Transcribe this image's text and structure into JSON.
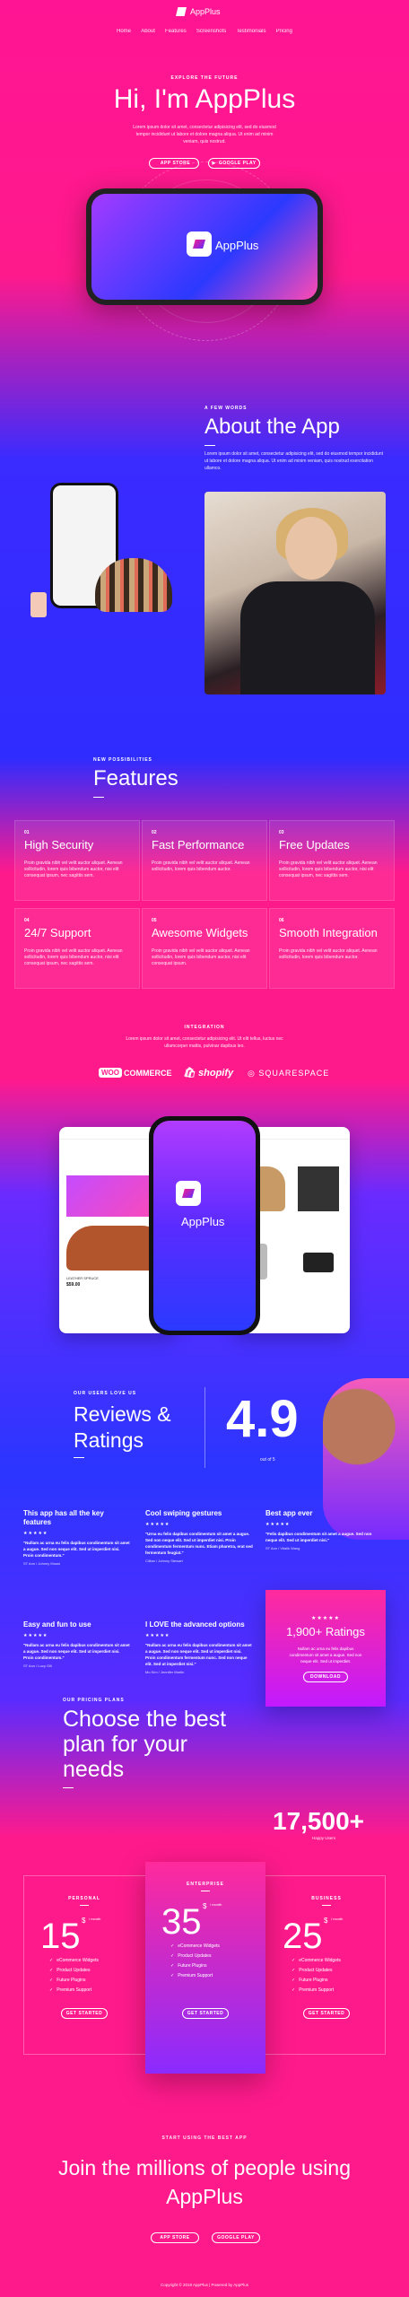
{
  "nav": {
    "brand": "AppPlus",
    "links": [
      "Home",
      "About",
      "Features",
      "Screenshots",
      "Testimonials",
      "Pricing"
    ]
  },
  "hero": {
    "eyebrow": "EXPLORE THE FUTURE",
    "title": "Hi, I'm AppPlus",
    "text": "Lorem ipsum dolor sit amet, consectetur adipisicing elit, sed do eiusmod tempor incididunt ut labore et dolore magna aliqua. Ut enim ad minim veniam, quis nostrud.",
    "btn_app_store": "APP STORE",
    "btn_google_play": "GOOGLE PLAY",
    "phone_app_name": "AppPlus"
  },
  "about": {
    "eyebrow": "A FEW WORDS",
    "title": "About the App",
    "text": "Lorem ipsum dolor sit amet, consectetur adipisicing elit, sed do eiusmod tempor incididunt ut labore et dolore magna aliqua. Ut enim ad minim veniam, quis nostrud exercitation ullamco."
  },
  "features": {
    "eyebrow": "NEW POSSIBILITIES",
    "title": "Features",
    "items": [
      {
        "num": "01",
        "title": "High Security",
        "text": "Proin gravida nibh vel velit auctor aliquet. Aenean sollicitudin, lorem quis bibendum auctor, nisi elit consequat ipsum, nec sagittis sem."
      },
      {
        "num": "02",
        "title": "Fast Performance",
        "text": "Proin gravida nibh vel velit auctor aliquet. Aenean sollicitudin, lorem quis bibendum auctor."
      },
      {
        "num": "03",
        "title": "Free Updates",
        "text": "Proin gravida nibh vel velit auctor aliquet. Aenean sollicitudin, lorem quis bibendum auctor, nisi elit consequat ipsum, nec sagittis sem."
      },
      {
        "num": "04",
        "title": "24/7 Support",
        "text": "Proin gravida nibh vel velit auctor aliquet. Aenean sollicitudin, lorem quis bibendum auctor, nisi elit consequat ipsum, nec sagittis sem."
      },
      {
        "num": "05",
        "title": "Awesome Widgets",
        "text": "Proin gravida nibh vel velit auctor aliquet. Aenean sollicitudin, lorem quis bibendum auctor, nisi elit consequat ipsum."
      },
      {
        "num": "06",
        "title": "Smooth Integration",
        "text": "Proin gravida nibh vel velit auctor aliquet. Aenean sollicitudin, lorem quis bibendum auctor."
      }
    ]
  },
  "integration": {
    "eyebrow": "INTEGRATION",
    "text": "Lorem ipsum dolor sit amet, consectetur adipisicing elit. Ut elit tellus, luctus nec ullamcorper mattis, pulvinar dapibus leo.",
    "woo_badge": "WOO",
    "woo_text": "COMMERCE",
    "shopify": "shopify",
    "squarespace": "SQUARESPACE",
    "panel_left_caption": "LEATHER SPRUCE",
    "panel_left_price": "$59.00",
    "phone_app_name": "AppPlus"
  },
  "reviews": {
    "eyebrow": "OUR USERS LOVE US",
    "title": "Reviews & Ratings",
    "score": "4.9",
    "out_of": "out of 5",
    "items": [
      {
        "title": "This app has all the key features",
        "stars": "★★★★★",
        "text": "\"Nullam ac urna eu felis dapibus condimentum sit amet a augue. Sed non neque elit. Sed ut imperdiet nisi. Proin condimentum.\"",
        "by": "ST Ann / Johnny Mussi"
      },
      {
        "title": "Cool swiping gestures",
        "stars": "★★★★★",
        "text": "\"Urna eu felis dapibus condimentum sit amet a augue. Sed non neque elit. Sed ut imperdiet nisi. Proin condimentum fermentum nunc. Etiam pharetra, erat sed fermentum feugiat.\"",
        "by": "Cillian / Johnny Stewart"
      },
      {
        "title": "Best app ever",
        "stars": "★★★★★",
        "text": "\"Felis dapibus condimentum sit amet a augue. Sed non neque elit. Sed ut imperdiet nisi.\"",
        "by": "ST Ann / Vitalik Wang"
      },
      {
        "title": "Easy and fun to use",
        "stars": "★★★★★",
        "text": "\"Nullam ac urna eu felis dapibus condimentum sit amet a augue. Sed non neque elit. Sed ut imperdiet nisi. Proin condimentum.\"",
        "by": "ST Ann / Lucy Gill"
      },
      {
        "title": "I LOVE the advanced options",
        "stars": "★★★★★",
        "text": "\"Nullam ac urna eu felis dapibus condimentum sit amet a augue. Sed non neque elit. Sed ut imperdiet nisi. Proin condimentum fermentum nunc. Sed non neque elit. Sed ut imperdiet nisi.\"",
        "by": "Mo Kim / Jennifer Martin"
      }
    ],
    "card_stars": "★★★★★",
    "card_big": "1,900+ Ratings",
    "card_text": "Nullam ac urna eu felis dapibus condimentum sit amet a augue. Sed non neque elit. Sed ut imperdiet.",
    "card_btn": "DOWNLOAD"
  },
  "pricing": {
    "eyebrow": "OUR PRICING PLANS",
    "title": "Choose the best plan for your needs",
    "big_number": "17,500+",
    "big_sub": "Happy Users",
    "plans": [
      {
        "name": "PERSONAL",
        "currency": "$",
        "amount": "15",
        "per": "/ month",
        "features": [
          "eCommerce Widgets",
          "Product Updates",
          "Future Plugins",
          "Premium Support"
        ],
        "btn": "GET STARTED"
      },
      {
        "name": "ENTERPRISE",
        "currency": "$",
        "amount": "35",
        "per": "/ month",
        "features": [
          "eCommerce Widgets",
          "Product Updates",
          "Future Plugins",
          "Premium Support"
        ],
        "btn": "GET STARTED"
      },
      {
        "name": "BUSINESS",
        "currency": "$",
        "amount": "25",
        "per": "/ month",
        "features": [
          "eCommerce Widgets",
          "Product Updates",
          "Future Plugins",
          "Premium Support"
        ],
        "btn": "GET STARTED"
      }
    ]
  },
  "cta": {
    "eyebrow": "START USING THE BEST APP",
    "title": "Join the millions of people using AppPlus",
    "btn_app_store": "APP STORE",
    "btn_google_play": "GOOGLE PLAY"
  },
  "footer": {
    "text": "Copyright © 2018 AppPlus | Powered by AppPlus"
  }
}
